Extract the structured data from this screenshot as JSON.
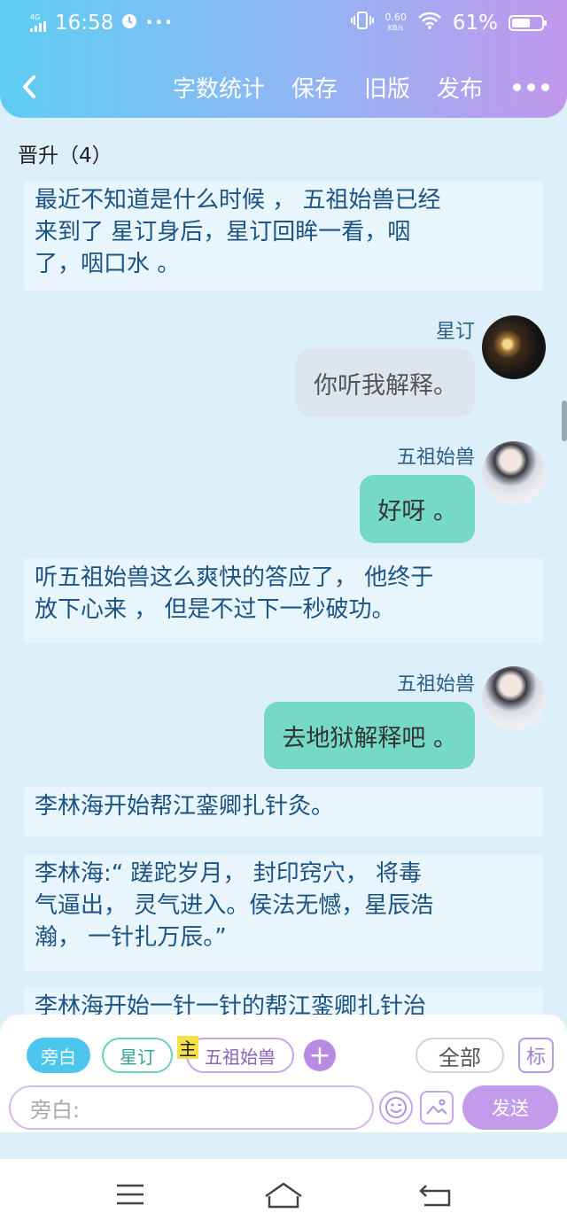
{
  "status_bar": {
    "network": "4G",
    "network_hd": "HD",
    "time": "16:58",
    "dots": "···",
    "net_speed_value": "0.60",
    "net_speed_unit": "KB/s",
    "battery_percent": "61%",
    "battery_level": 0.61
  },
  "header": {
    "back_icon": "chevron-left-icon",
    "actions": [
      "字数统计",
      "保存",
      "旧版",
      "发布"
    ],
    "more_icon": "more-dots-icon",
    "gradient_colors": [
      "#5ecdf2",
      "#c197ed"
    ]
  },
  "chapter_title": "晋升（4）",
  "messages": [
    {
      "type": "narration",
      "text_lines": [
        "最近不知道是什么时候 ， 五祖始兽已经",
        "来到了 星订身后，星订回眸一看，咽",
        "了，咽口水 。"
      ]
    },
    {
      "type": "speech",
      "speaker": "星订",
      "text": "你听我解释。",
      "bubble": "gray",
      "avatar": "dark-lantern-avatar"
    },
    {
      "type": "speech",
      "speaker": "五祖始兽",
      "text": "好呀 。",
      "bubble": "teal",
      "avatar": "white-robed-avatar"
    },
    {
      "type": "narration",
      "text_lines": [
        "听五祖始兽这么爽快的答应了， 他终于",
        "放下心来 ， 但是不过下一秒破功。"
      ]
    },
    {
      "type": "speech",
      "speaker": "五祖始兽",
      "text": "去地狱解释吧 。",
      "bubble": "teal",
      "avatar": "white-robed-avatar"
    },
    {
      "type": "narration",
      "text_lines": [
        "李林海开始帮江銮卿扎针灸。"
      ]
    },
    {
      "type": "narration",
      "text_lines": [
        "李林海:“ 蹉跎岁月， 封印窍穴， 将毒",
        "气逼出， 灵气进入。侯法无憾，星辰浩",
        "瀚， 一针扎万辰。”"
      ]
    },
    {
      "type": "narration",
      "text_lines": [
        "李林海开始一针一针的帮江銮卿扎针治"
      ]
    }
  ],
  "input_panel": {
    "roles": {
      "narrator": "旁白",
      "star": "星订",
      "wu": "五祖始兽"
    },
    "main_tag": "主",
    "add": "+",
    "all": "全部",
    "mark": "标",
    "input_placeholder": "旁白:",
    "send": "发送"
  },
  "colors": {
    "chat_bg": "#ddf0fa",
    "teal_bubble": "#76d9c6",
    "gray_bubble": "#dde6ee",
    "accent_purple": "#c39beb",
    "accent_blue": "#4cc6ee"
  }
}
